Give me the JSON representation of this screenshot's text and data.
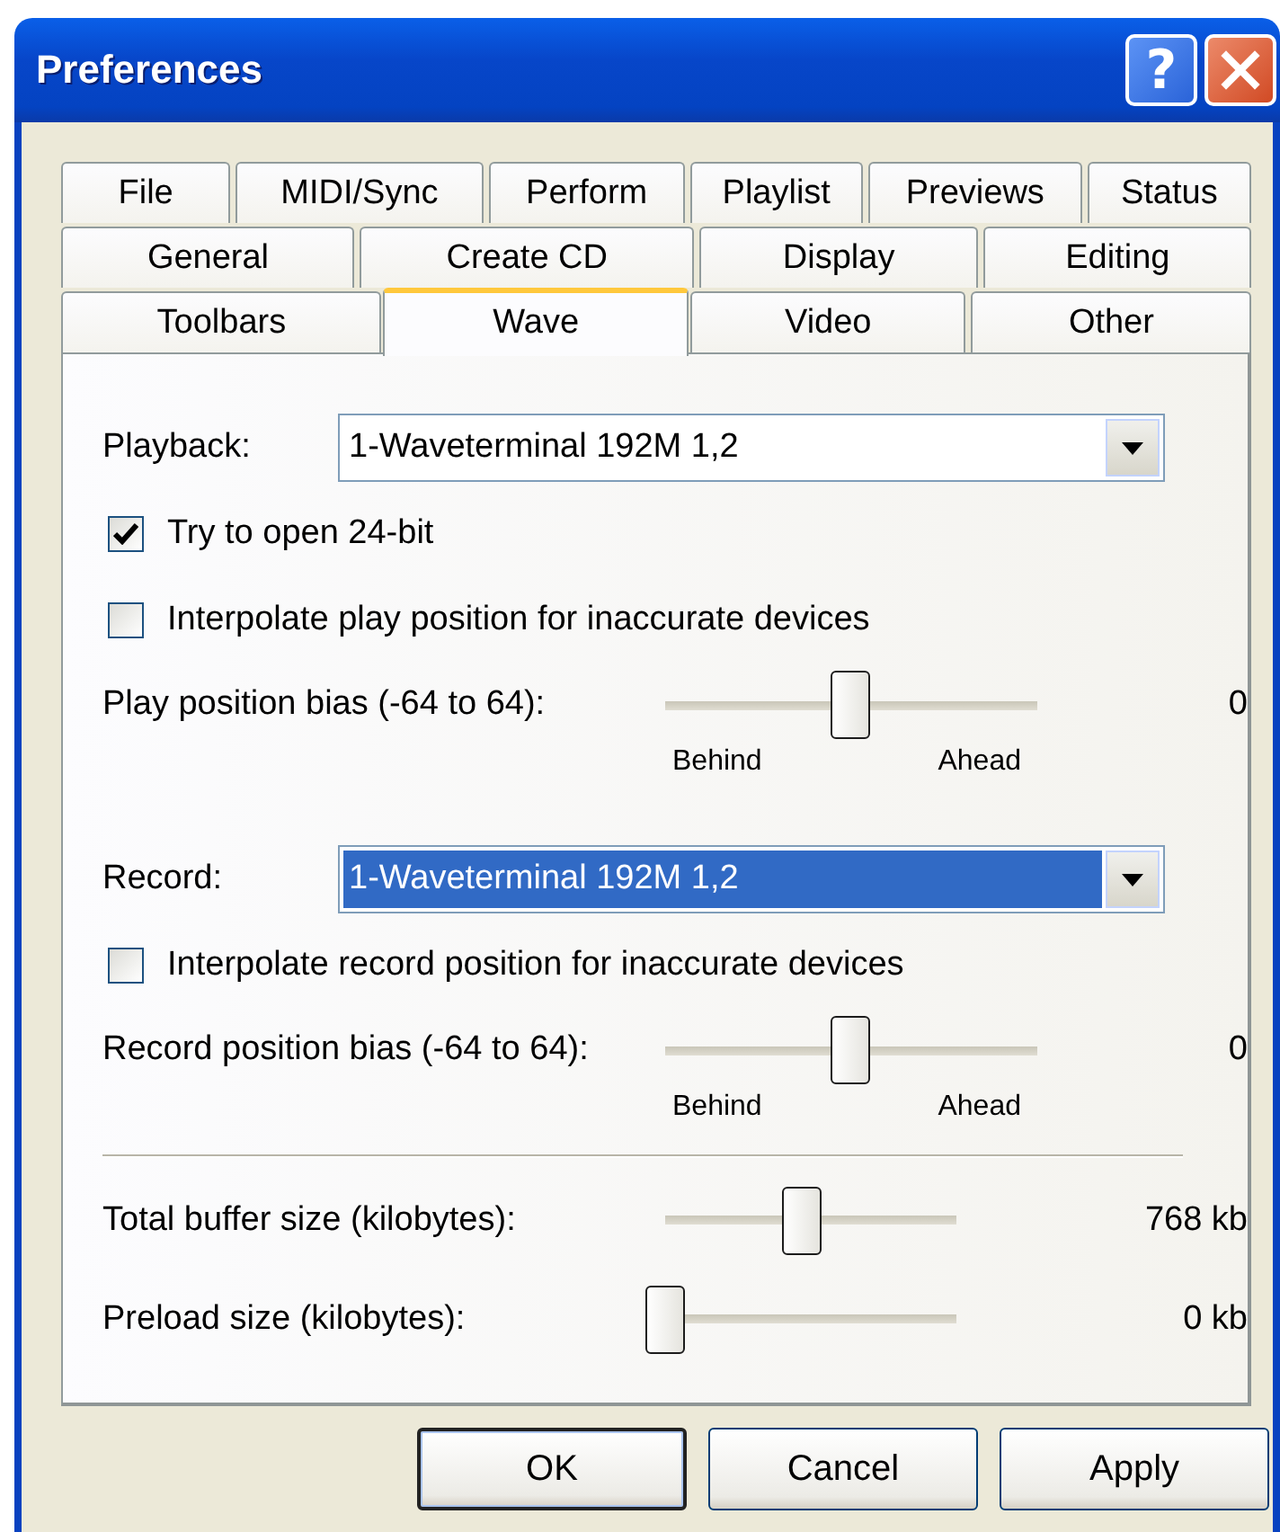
{
  "window": {
    "title": "Preferences",
    "help_button": "?"
  },
  "tab_rows": [
    [
      {
        "label": "File",
        "selected": false
      },
      {
        "label": "MIDI/Sync",
        "selected": false
      },
      {
        "label": "Perform",
        "selected": false
      },
      {
        "label": "Playlist",
        "selected": false
      },
      {
        "label": "Previews",
        "selected": false
      },
      {
        "label": "Status",
        "selected": false
      }
    ],
    [
      {
        "label": "General",
        "selected": false
      },
      {
        "label": "Create CD",
        "selected": false
      },
      {
        "label": "Display",
        "selected": false
      },
      {
        "label": "Editing",
        "selected": false
      }
    ],
    [
      {
        "label": "Toolbars",
        "selected": false
      },
      {
        "label": "Wave",
        "selected": true
      },
      {
        "label": "Video",
        "selected": false
      },
      {
        "label": "Other",
        "selected": false
      }
    ]
  ],
  "panel": {
    "rows": [
      {
        "kind": "dropdown",
        "label": "Playback:",
        "value": "1-Waveterminal 192M 1,2",
        "focused": false
      },
      {
        "kind": "checkbox",
        "label": "Try to open 24-bit",
        "checked": true
      },
      {
        "kind": "checkbox",
        "label": "Interpolate play position for inaccurate devices",
        "checked": false
      },
      {
        "kind": "slider",
        "label": "Play position bias (-64 to 64):",
        "level": 0.5,
        "reading": "0",
        "ticks": [
          "Behind",
          "Ahead"
        ]
      },
      {
        "kind": "dropdown",
        "label": "Record:",
        "value": "1-Waveterminal 192M 1,2",
        "focused": true
      },
      {
        "kind": "checkbox",
        "label": "Interpolate record position for inaccurate devices",
        "checked": false
      },
      {
        "kind": "slider",
        "label": "Record position bias (-64 to 64):",
        "level": 0.5,
        "reading": "0",
        "ticks": [
          "Behind",
          "Ahead"
        ]
      },
      {
        "kind": "divider"
      },
      {
        "kind": "slider",
        "label": "Total buffer size (kilobytes):",
        "level": 0.47,
        "reading": "768 kb"
      },
      {
        "kind": "slider",
        "label": "Preload size (kilobytes):",
        "level": 0,
        "reading": "0 kb"
      }
    ]
  },
  "buttons": [
    {
      "label": "OK",
      "default": true
    },
    {
      "label": "Cancel",
      "default": false
    },
    {
      "label": "Apply",
      "default": false
    }
  ]
}
